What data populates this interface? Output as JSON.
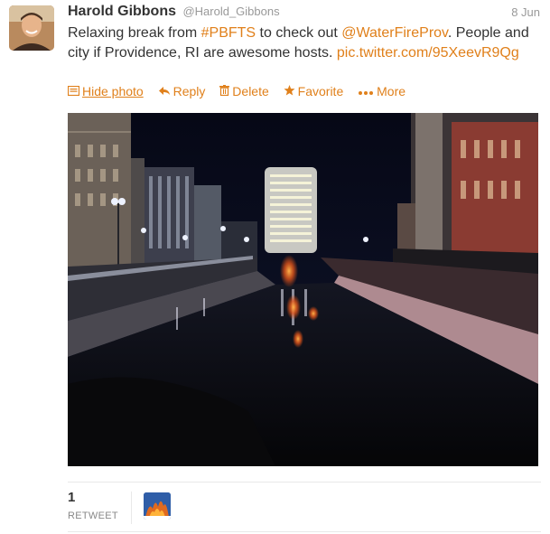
{
  "tweet": {
    "author": {
      "fullname": "Harold Gibbons",
      "username": "@Harold_Gibbons",
      "avatar": "profile-photo"
    },
    "timestamp": "8 Jun",
    "text": {
      "part1": "Relaxing break from ",
      "hashtag": "#PBFTS",
      "part2": " to check out ",
      "mention": "@WaterFireProv",
      "part3": ". People and city if Providence, RI are awesome hosts. ",
      "pic_link": "pic.twitter.com/95XeevR9Qg"
    },
    "actions": {
      "hide_photo": {
        "label": "Hide photo",
        "icon": "photo-icon"
      },
      "reply": {
        "label": "Reply",
        "icon": "reply-arrow-icon"
      },
      "delete": {
        "label": "Delete",
        "icon": "trash-icon"
      },
      "favorite": {
        "label": "Favorite",
        "icon": "star-icon"
      },
      "more": {
        "label": "More",
        "icon": "ellipsis-icon"
      }
    },
    "media": {
      "type": "photo",
      "subject": "night canal"
    },
    "stats": {
      "retweet_count": "1",
      "retweet_label": "RETWEET"
    },
    "colors": {
      "link": "#e0801b",
      "text": "#333333",
      "muted": "#999999"
    }
  }
}
